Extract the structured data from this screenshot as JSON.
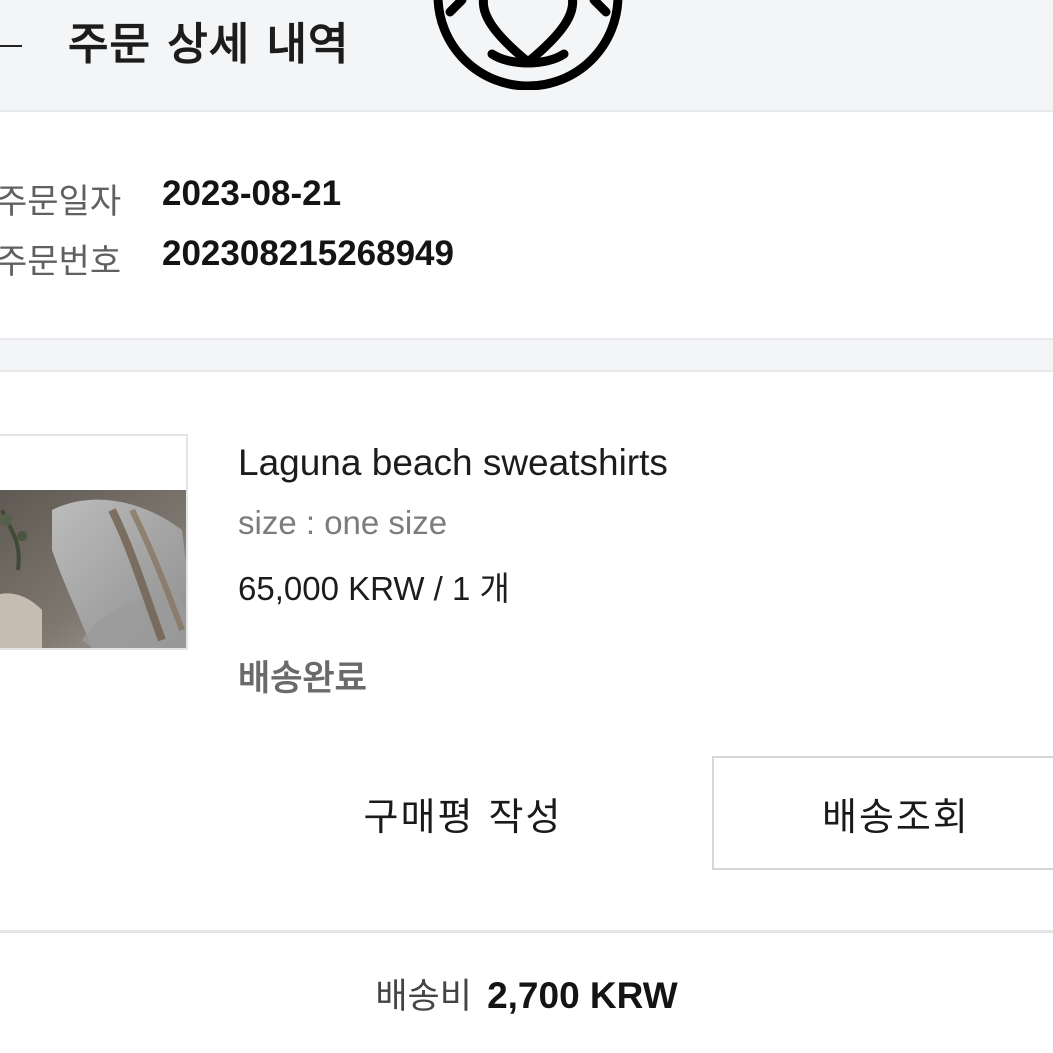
{
  "header": {
    "title": "주문 상세 내역",
    "back_icon": "arrow-left-icon",
    "logo_icon": "circle-heart-logo-icon"
  },
  "order": {
    "date_label": "주문일자",
    "date_value": "2023-08-21",
    "number_label": "주문번호",
    "number_value": "202308215268949"
  },
  "product": {
    "name": "Laguna beach sweatshirts",
    "option": "size : one size",
    "price": "65,000 KRW / 1 개",
    "status": "배송완료"
  },
  "actions": {
    "review_label": "구매평 작성",
    "track_label": "배송조회"
  },
  "shipping": {
    "label": "배송비",
    "value": "2,700 KRW"
  },
  "colors": {
    "header_bg": "#f4f5f7",
    "text_primary": "#1a1a1a",
    "text_muted": "#7c7c7c",
    "border": "#d8d8d8"
  }
}
